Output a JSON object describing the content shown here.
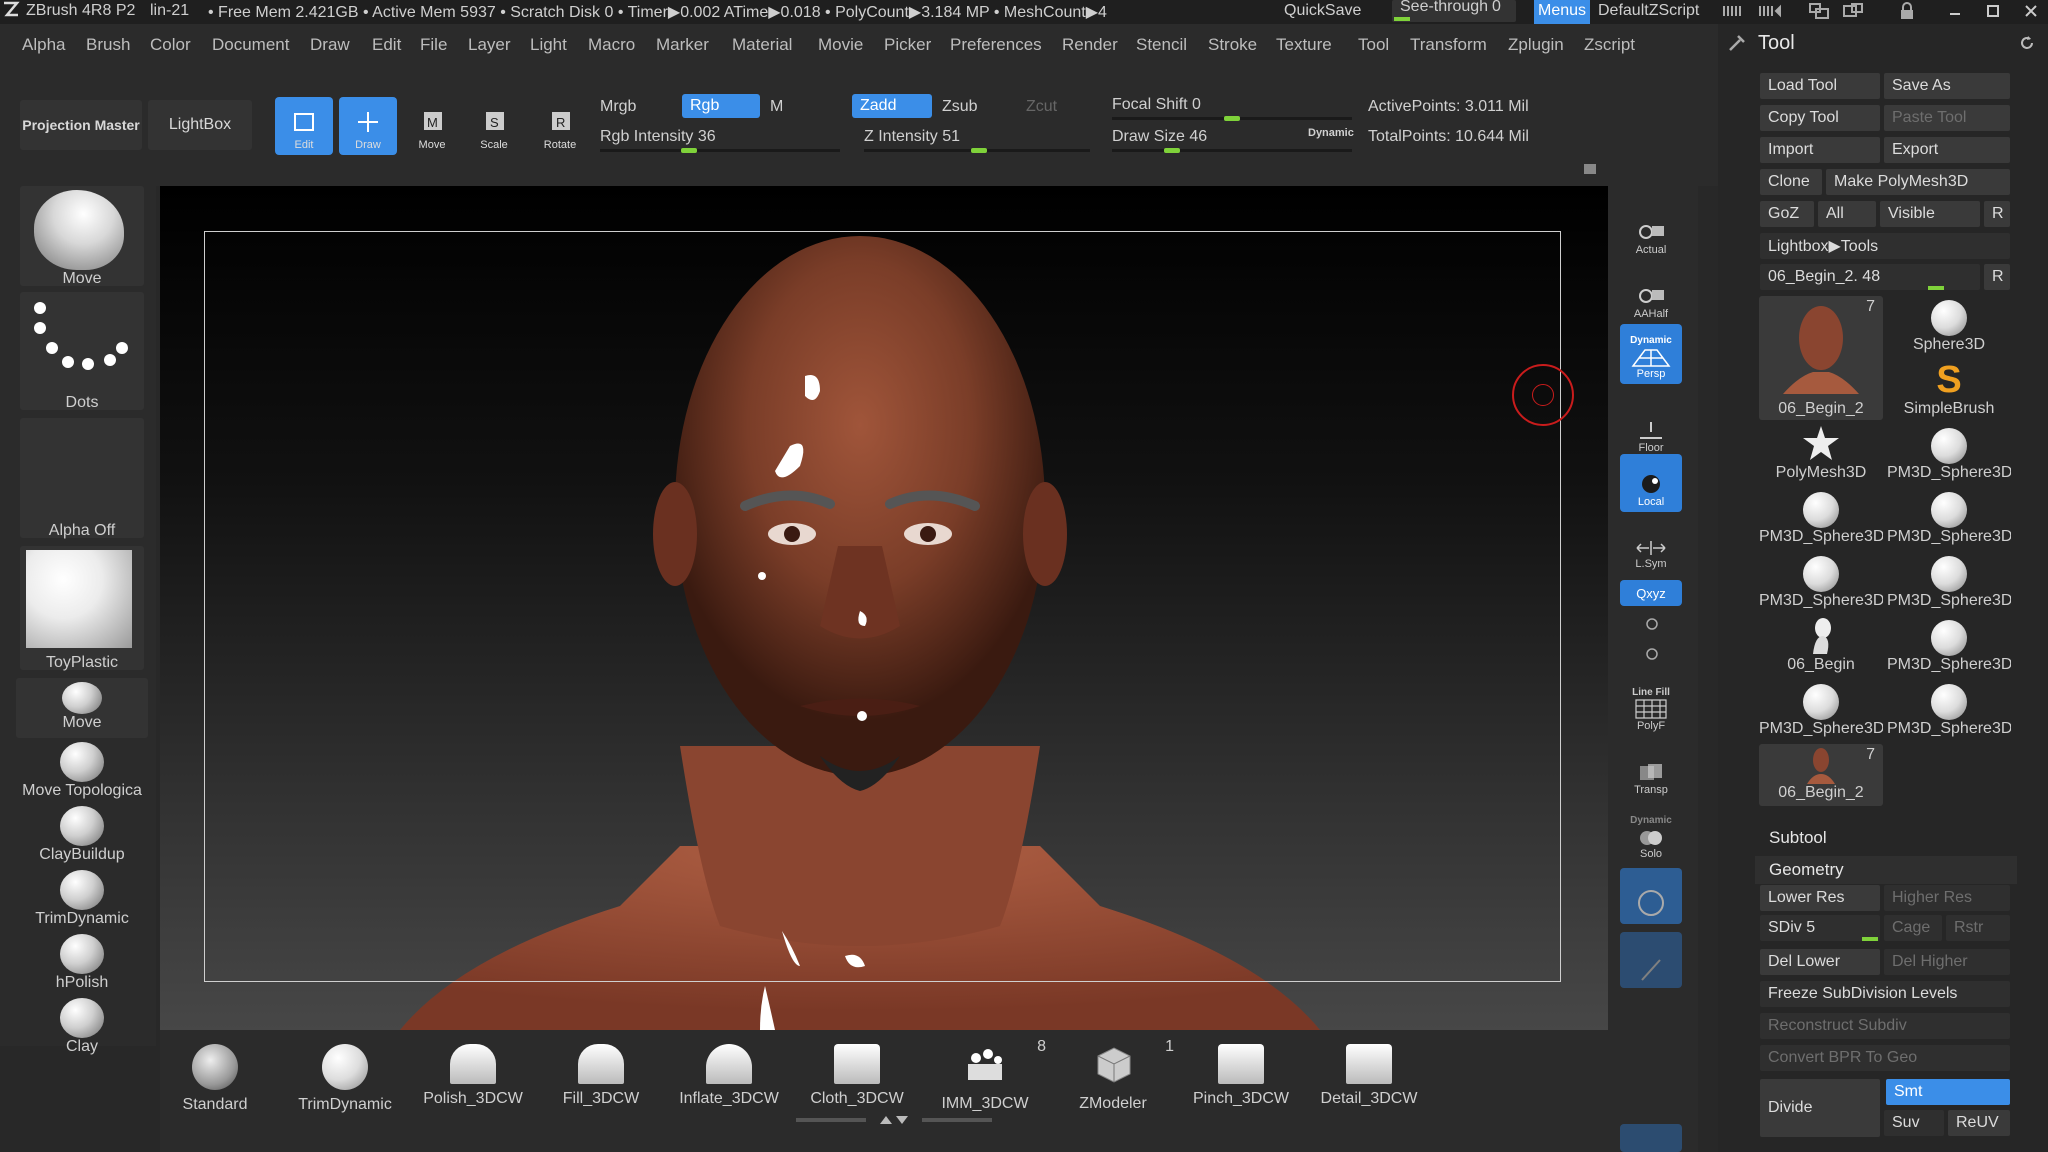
{
  "titlebar": {
    "app": "ZBrush 4R8 P2",
    "build": "lin-21",
    "stats": "• Free Mem 2.421GB • Active Mem 5937 • Scratch Disk 0 • Timer▶0.002 ATime▶0.018 • PolyCount▶3.184 MP • MeshCount▶4",
    "quicksave": "QuickSave",
    "seethrough": "See-through",
    "seethrough_value": "0",
    "menus": "Menus",
    "script": "DefaultZScript"
  },
  "menubar": [
    "Alpha",
    "Brush",
    "Color",
    "Document",
    "Draw",
    "Edit",
    "File",
    "Layer",
    "Light",
    "Macro",
    "Marker",
    "Material",
    "Movie",
    "Picker",
    "Preferences",
    "Render",
    "Stencil",
    "Stroke",
    "Texture",
    "Tool",
    "Transform",
    "Zplugin",
    "Zscript"
  ],
  "toolbar": {
    "projection_master": "Projection Master",
    "lightbox": "LightBox",
    "edit": "Edit",
    "draw": "Draw",
    "move": "Move",
    "scale": "Scale",
    "rotate": "Rotate",
    "mrgb": "Mrgb",
    "rgb": "Rgb",
    "m": "M",
    "zadd": "Zadd",
    "zsub": "Zsub",
    "zcut": "Zcut",
    "rgb_intensity": "Rgb Intensity 36",
    "z_intensity": "Z Intensity 51",
    "focal_shift": "Focal Shift 0",
    "draw_size": "Draw Size 46",
    "dynamic": "Dynamic",
    "active_points": "ActivePoints: 3.011 Mil",
    "total_points": "TotalPoints: 10.644 Mil",
    "rgb_intensity_value": 36,
    "z_intensity_value": 51,
    "draw_size_value": 46
  },
  "leftpanel": {
    "brush": "Move",
    "stroke": "Dots",
    "alpha": "Alpha Off",
    "material": "ToyPlastic",
    "brushes": [
      "Move",
      "Move Topologica",
      "ClayBuildup",
      "TrimDynamic",
      "hPolish",
      "Clay"
    ]
  },
  "rightshelf": {
    "actual": "Actual",
    "aahalf": "AAHalf",
    "dynamic": "Dynamic",
    "persp": "Persp",
    "floor": "Floor",
    "local": "Local",
    "lsym": "L.Sym",
    "xyz": "Qxyz",
    "line_fill": "Line Fill",
    "polyf": "PolyF",
    "transp": "Transp",
    "dynamic2": "Dynamic",
    "solo": "Solo"
  },
  "bottomshelf": [
    {
      "label": "Standard"
    },
    {
      "label": "TrimDynamic"
    },
    {
      "label": "Polish_3DCW"
    },
    {
      "label": "Fill_3DCW"
    },
    {
      "label": "Inflate_3DCW"
    },
    {
      "label": "Cloth_3DCW"
    },
    {
      "label": "IMM_3DCW",
      "badge": "8"
    },
    {
      "label": "ZModeler",
      "badge": "1"
    },
    {
      "label": "Pinch_3DCW"
    },
    {
      "label": "Detail_3DCW"
    }
  ],
  "toolpanel": {
    "title": "Tool",
    "load_tool": "Load Tool",
    "save_as": "Save As",
    "copy_tool": "Copy Tool",
    "paste_tool": "Paste Tool",
    "import": "Import",
    "export": "Export",
    "clone": "Clone",
    "make_polymesh": "Make PolyMesh3D",
    "goz": "GoZ",
    "all": "All",
    "visible": "Visible",
    "r": "R",
    "lightbox_tools": "Lightbox▶Tools",
    "current_tool": "06_Begin_2. 48",
    "tools": [
      {
        "label": "06_Begin_2",
        "badge": "7",
        "kind": "head"
      },
      {
        "label": "Sphere3D",
        "kind": "sphere"
      },
      {
        "label": "SimpleBrush",
        "kind": "s"
      },
      {
        "label": "PolyMesh3D",
        "kind": "star"
      },
      {
        "label": "PM3D_Sphere3D",
        "kind": "sphere"
      },
      {
        "label": "PM3D_Sphere3D",
        "kind": "sphere"
      },
      {
        "label": "PM3D_Sphere3D",
        "kind": "sphere"
      },
      {
        "label": "PM3D_Sphere3D",
        "kind": "sphere"
      },
      {
        "label": "PM3D_Sphere3D",
        "kind": "sphere"
      },
      {
        "label": "06_Begin",
        "kind": "figure"
      },
      {
        "label": "PM3D_Sphere3D",
        "kind": "sphere"
      },
      {
        "label": "PM3D_Sphere3D",
        "kind": "sphere"
      },
      {
        "label": "PM3D_Sphere3D",
        "kind": "sphere"
      },
      {
        "label": "06_Begin_2",
        "badge": "7",
        "kind": "headsm"
      }
    ],
    "subtool": "Subtool",
    "geometry": "Geometry",
    "lower_res": "Lower Res",
    "higher_res": "Higher Res",
    "sdiv": "SDiv 5",
    "cage": "Cage",
    "rstr": "Rstr",
    "del_lower": "Del Lower",
    "del_higher": "Del Higher",
    "freeze": "Freeze SubDivision Levels",
    "reconstruct": "Reconstruct Subdiv",
    "convert_bpr": "Convert BPR To Geo",
    "divide": "Divide",
    "smt": "Smt",
    "suv": "Suv",
    "reuv": "ReUV"
  }
}
